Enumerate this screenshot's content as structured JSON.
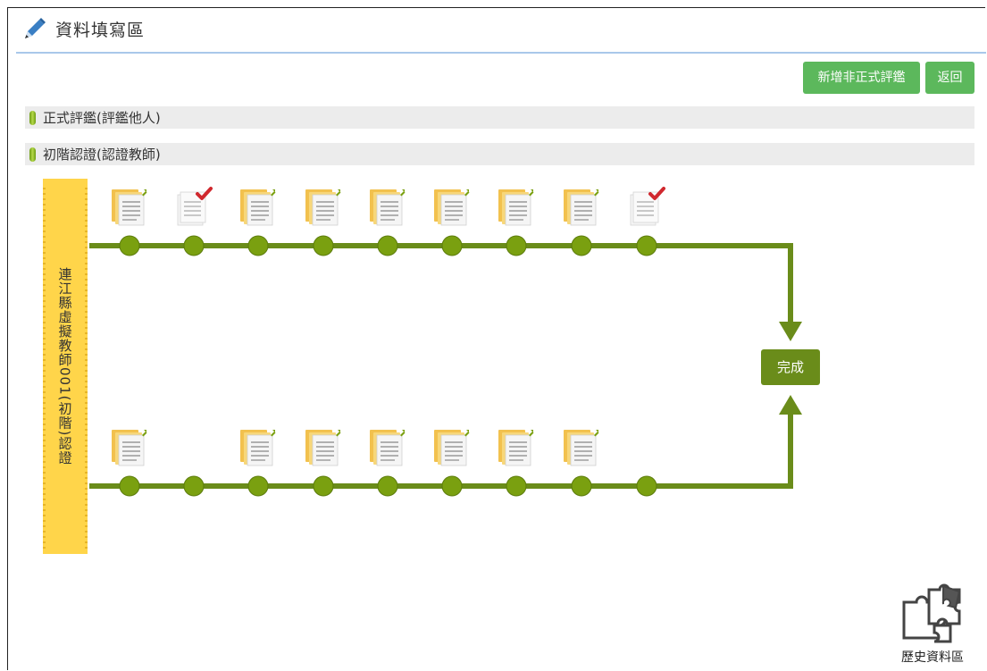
{
  "header": {
    "title": "資料填寫區",
    "icon": "pencil-icon"
  },
  "toolbar": {
    "add_label": "新增非正式評鑑",
    "back_label": "返回"
  },
  "sections": [
    {
      "label": "正式評鑑(評鑑他人)"
    },
    {
      "label": "初階認證(認證教師)"
    }
  ],
  "teacher": {
    "name": "連江縣虛擬教師001(初階)認證"
  },
  "flow": {
    "done_label": "完成",
    "top_row": [
      "doc",
      "check",
      "doc",
      "doc",
      "doc",
      "doc",
      "doc",
      "doc",
      "check"
    ],
    "bottom_row": [
      "doc",
      "none",
      "doc",
      "doc",
      "doc",
      "doc",
      "doc",
      "doc",
      "none"
    ]
  },
  "history": {
    "label": "歷史資料區",
    "icon": "puzzle-icon"
  },
  "colors": {
    "accent_green": "#5cb85c",
    "line_green": "#6a8c1a",
    "node_green": "#7aa010",
    "name_bar_yellow": "#ffd54a",
    "header_line": "#a9c8ea",
    "check_red": "#d0282e"
  }
}
